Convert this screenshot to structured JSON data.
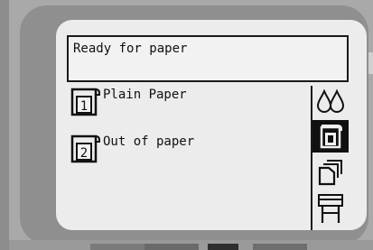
{
  "status": {
    "message": "Ready for paper"
  },
  "trays": [
    {
      "number": "1",
      "label": "Plain Paper",
      "icon": "tray-1-icon"
    },
    {
      "number": "2",
      "label": "Out of paper",
      "icon": "tray-2-icon"
    }
  ],
  "sidebar": {
    "items": [
      {
        "name": "ink-drops-icon",
        "selected": false
      },
      {
        "name": "paper-rolls-icon",
        "selected": true
      },
      {
        "name": "sheet-stack-icon",
        "selected": false
      },
      {
        "name": "printer-icon",
        "selected": false
      }
    ]
  },
  "colors": {
    "screen_bg": "#ececec",
    "bezel": "#8f8f8f",
    "selected_bg": "#111111"
  }
}
